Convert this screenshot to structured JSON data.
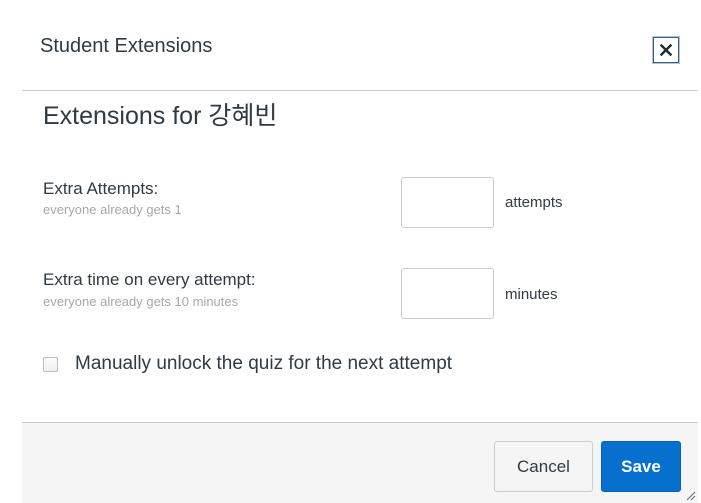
{
  "dialog": {
    "title": "Student Extensions",
    "close_icon": "close-x-icon"
  },
  "content": {
    "heading": "Extensions for 강혜빈",
    "extra_attempts": {
      "label": "Extra Attempts:",
      "hint": "everyone already gets 1",
      "value": "",
      "unit": "attempts"
    },
    "extra_time": {
      "label": "Extra time on every attempt:",
      "hint": "everyone already gets 10 minutes",
      "value": "",
      "unit": "minutes"
    },
    "manual_unlock": {
      "label": "Manually unlock the quiz for the next attempt",
      "checked": false
    }
  },
  "footer": {
    "cancel_label": "Cancel",
    "save_label": "Save"
  },
  "colors": {
    "primary": "#0770cf",
    "text": "#2d3b45",
    "hint": "#a2a9ae",
    "border": "#c7cdd1",
    "footer_bg": "#f5f5f5"
  }
}
